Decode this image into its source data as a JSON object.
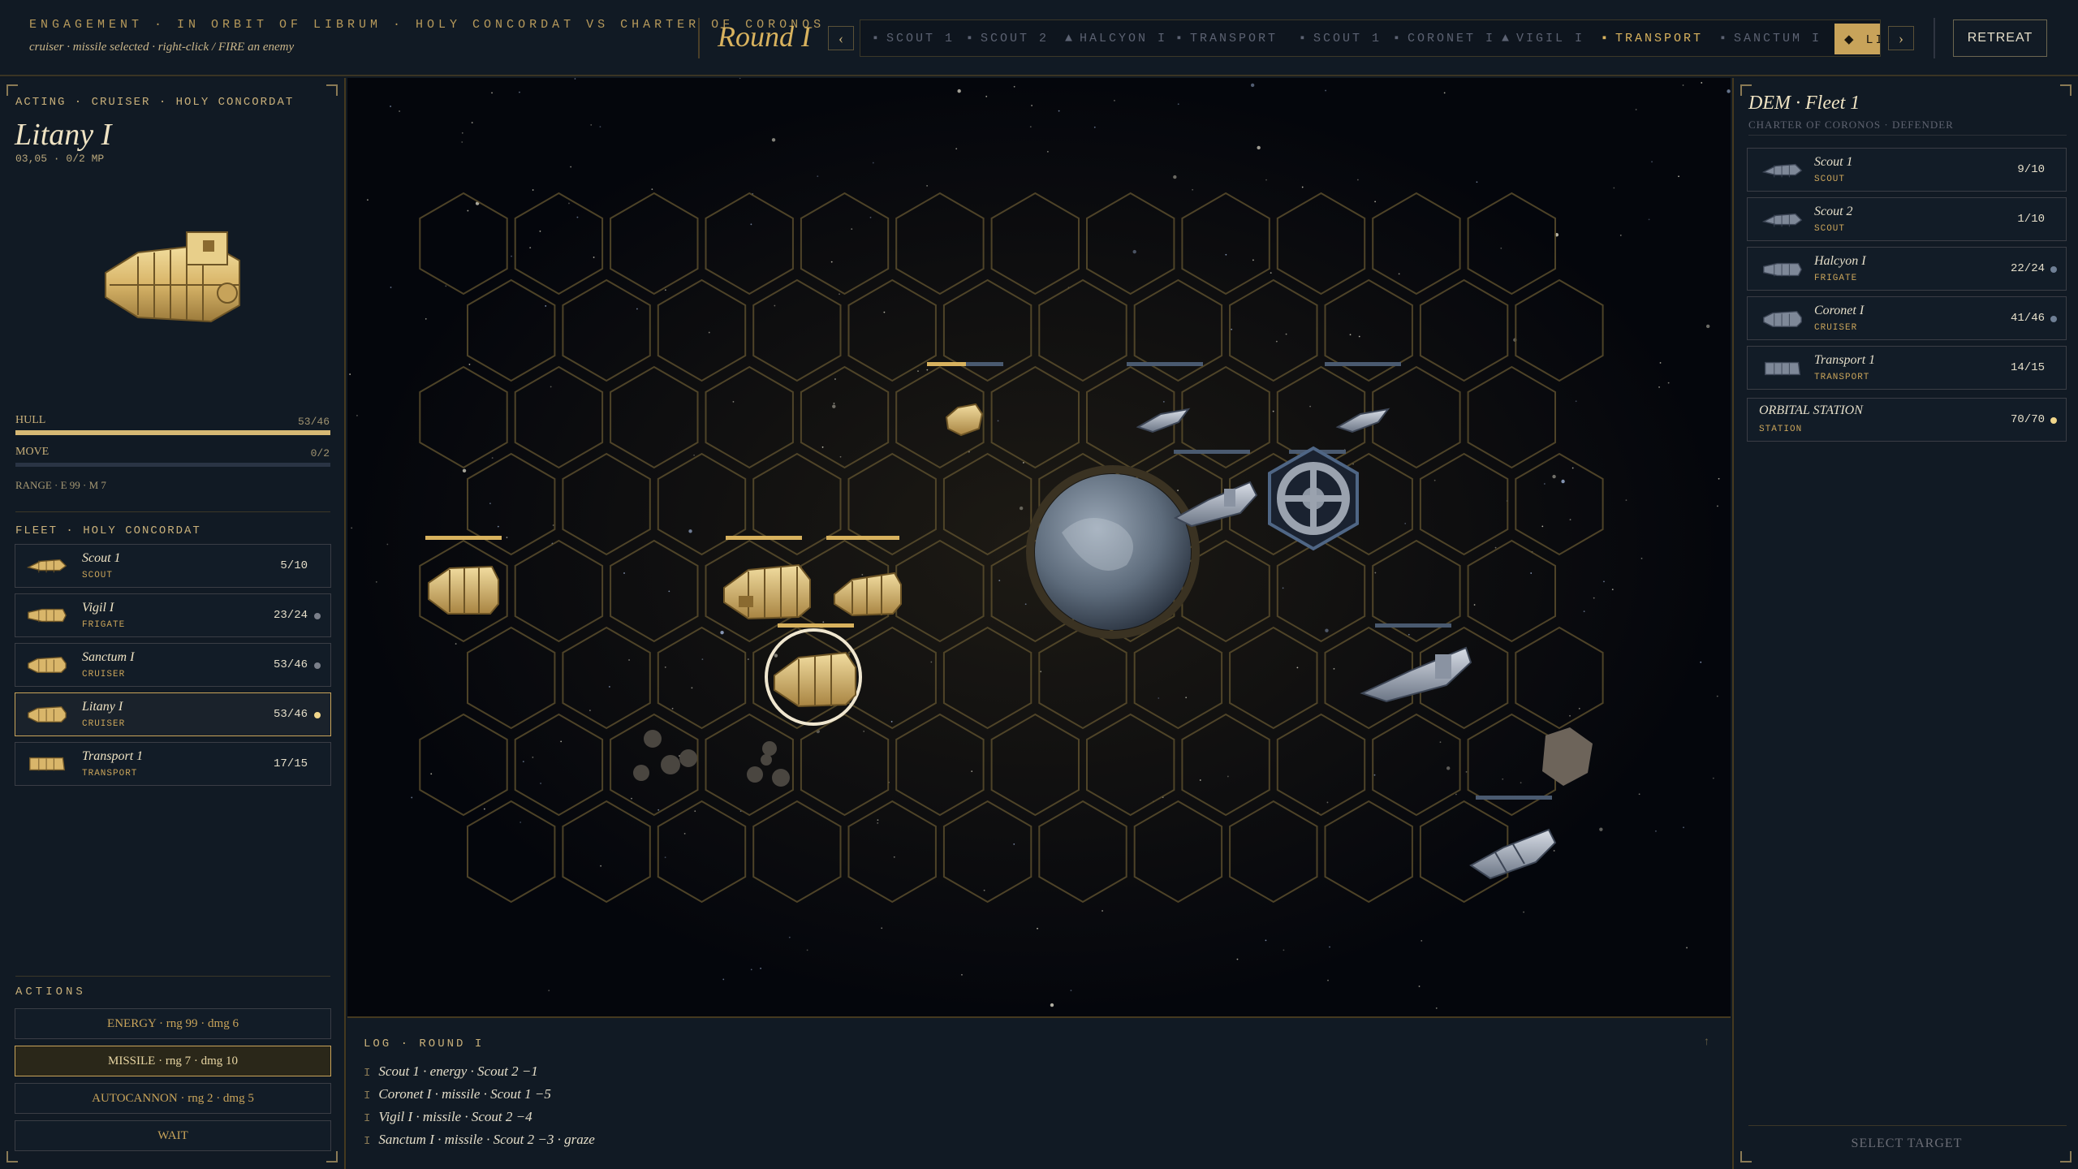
{
  "topbar": {
    "title": "ENGAGEMENT · IN ORBIT OF LIBRUM · HOLY CONCORDAT VS CHARTER OF CORONOS",
    "subtitle": "cruiser · missile selected · right-click / FIRE an enemy",
    "round": "Round I",
    "prev": "‹",
    "next": "›",
    "retreat": "RETREAT",
    "turn_order": [
      {
        "mark": "▪",
        "label": "SCOUT 1",
        "active": false
      },
      {
        "mark": "▪",
        "label": "SCOUT 2",
        "active": false
      },
      {
        "mark": "▲",
        "label": "HALCYON I",
        "active": false
      },
      {
        "mark": "▪",
        "label": "TRANSPORT",
        "active": false
      },
      {
        "mark": "▪",
        "label": "SCOUT 1",
        "active": false
      },
      {
        "mark": "▪",
        "label": "CORONET I",
        "active": false
      },
      {
        "mark": "▲",
        "label": "VIGIL I",
        "active": false
      },
      {
        "mark": "▪",
        "label": "TRANSPORT",
        "active": true
      },
      {
        "mark": "▪",
        "label": "SANCTUM I",
        "active": false
      }
    ],
    "current": "◆ LI"
  },
  "acting": {
    "label": "ACTING · CRUISER · HOLY CONCORDAT",
    "name": "Litany I",
    "coords": "03,05 · 0/2 MP",
    "hull_label": "HULL",
    "hull_value": "53/46",
    "hull_fraction": 1.0,
    "move_label": "MOVE",
    "move_value": "0/2",
    "move_fraction": 0,
    "range": "RANGE · E 99 · M 7"
  },
  "fleet": {
    "header": "FLEET · HOLY CONCORDAT",
    "ships": [
      {
        "name": "Scout 1",
        "cls": "SCOUT",
        "hp": "5/10",
        "dot": ""
      },
      {
        "name": "Vigil I",
        "cls": "FRIGATE",
        "hp": "23/24",
        "dot": "#7a7f8a"
      },
      {
        "name": "Sanctum I",
        "cls": "CRUISER",
        "hp": "53/46",
        "dot": "#7a7f8a"
      },
      {
        "name": "Litany I",
        "cls": "CRUISER",
        "hp": "53/46",
        "dot": "#f0d58a",
        "selected": true
      },
      {
        "name": "Transport 1",
        "cls": "TRANSPORT",
        "hp": "17/15",
        "dot": ""
      }
    ]
  },
  "actions": {
    "header": "ACTIONS",
    "buttons": [
      {
        "label": "ENERGY · rng 99 · dmg 6",
        "selected": false
      },
      {
        "label": "MISSILE · rng 7 · dmg 10",
        "selected": true
      },
      {
        "label": "AUTOCANNON · rng 2 · dmg 5",
        "selected": false
      },
      {
        "label": "WAIT",
        "selected": false
      }
    ]
  },
  "log": {
    "header": "LOG · ROUND I",
    "up": "↑",
    "prefix": "I",
    "lines": [
      "Scout 1 · energy · Scout 2 −1",
      "Coronet I · missile · Scout 1 −5",
      "Vigil I · missile · Scout 2 −4",
      "Sanctum I · missile · Scout 2 −3 · graze"
    ]
  },
  "enemy": {
    "title": "DEM · Fleet 1",
    "subtitle": "CHARTER OF CORONOS · DEFENDER",
    "ships": [
      {
        "name": "Scout 1",
        "cls": "SCOUT",
        "hp": "9/10",
        "dot": ""
      },
      {
        "name": "Scout 2",
        "cls": "SCOUT",
        "hp": "1/10",
        "dot": ""
      },
      {
        "name": "Halcyon I",
        "cls": "FRIGATE",
        "hp": "22/24",
        "dot": "#6f7f95"
      },
      {
        "name": "Coronet I",
        "cls": "CRUISER",
        "hp": "41/46",
        "dot": "#6f7f95"
      },
      {
        "name": "Transport 1",
        "cls": "TRANSPORT",
        "hp": "14/15",
        "dot": ""
      }
    ],
    "station": {
      "name": "ORBITAL STATION",
      "cls": "STATION",
      "hp": "70/70",
      "dot": "#f0d58a"
    },
    "select_target": "SELECT TARGET"
  },
  "colors": {
    "accent": "#d8b25e",
    "enemy": "#5f7390",
    "background": "#111a24"
  }
}
